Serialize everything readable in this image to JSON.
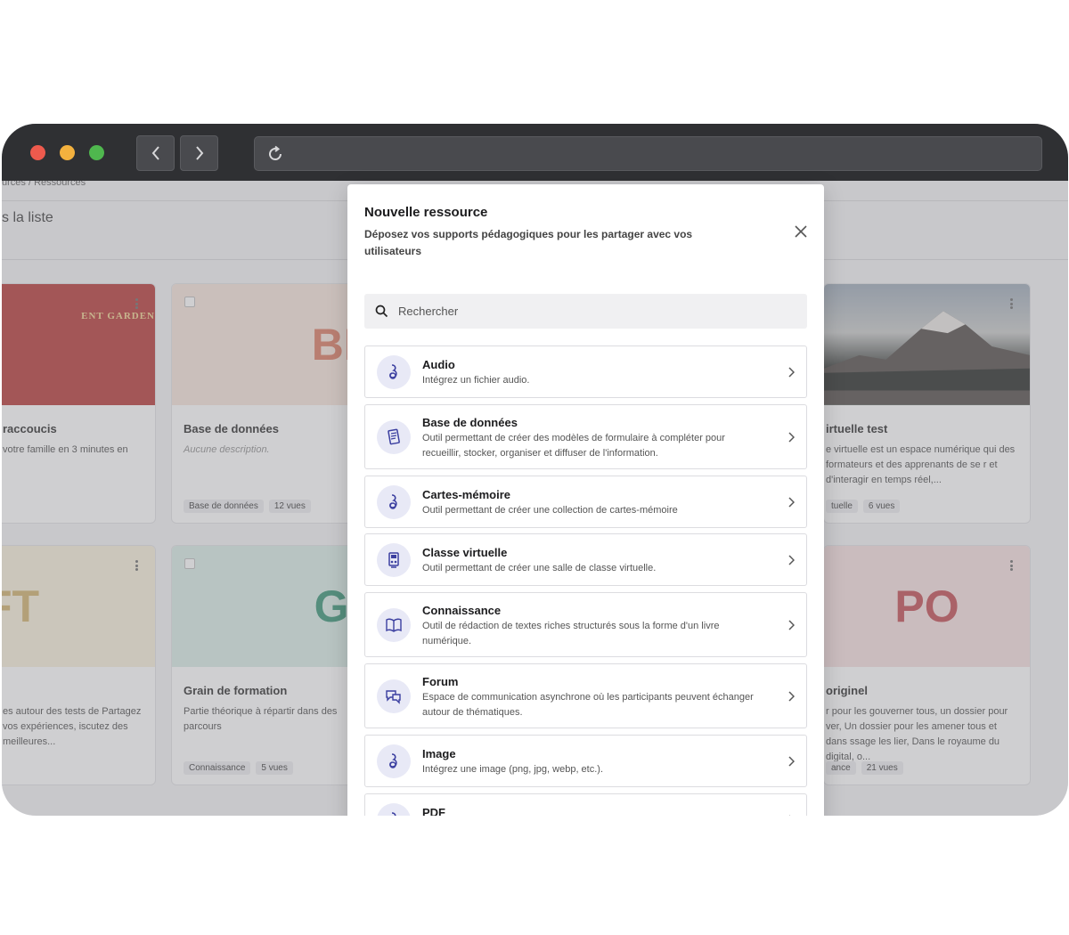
{
  "browser": {
    "traffic_lights": [
      "close",
      "minimize",
      "maximize"
    ],
    "icons": {
      "back": "chevron-left-icon",
      "forward": "chevron-right-icon",
      "reload": "reload-icon"
    },
    "url": ""
  },
  "background_page": {
    "breadcrumb": "urces  /  Ressources",
    "list_title": "s la liste",
    "cards": [
      {
        "cover_text": "ENT GARDEN",
        "title": "raccoucis",
        "desc": "votre famille en 3 minutes en",
        "tags": []
      },
      {
        "cover_text": "BD",
        "title": "Base de données",
        "desc": "Aucune description.",
        "tags": [
          "Base de données",
          "12 vues"
        ]
      },
      {
        "cover_text": "",
        "title": "irtuelle test",
        "desc": "e virtuelle est un espace numérique qui des formateurs et des apprenants de se r et d'interagir en temps réel,...",
        "tags": [
          "tuelle",
          "6 vues"
        ]
      },
      {
        "cover_text": "FT",
        "title": "",
        "desc": "es autour des tests de Partagez vos expériences, iscutez des meilleures...",
        "tags": []
      },
      {
        "cover_text": "GF",
        "title": "Grain de formation",
        "desc": "Partie théorique à répartir dans des parcours",
        "tags": [
          "Connaissance",
          "5 vues"
        ]
      },
      {
        "cover_text": "PO",
        "title": "originel",
        "desc": "r pour les gouverner tous, un dossier pour ver, Un dossier pour les amener tous et dans ssage les lier, Dans le royaume du digital, o...",
        "tags": [
          "ance",
          "21 vues"
        ]
      }
    ],
    "colors": {
      "bd": "#d9a08a",
      "gf": "#2e8f6e",
      "ft": "#cfae66",
      "po": "#c0444a"
    }
  },
  "modal": {
    "title": "Nouvelle ressource",
    "subtitle": "Déposez vos supports pédagogiques pour les partager avec vos utilisateurs",
    "close_icon": "close-icon",
    "search": {
      "placeholder": "Rechercher",
      "icon": "search-icon"
    },
    "items": [
      {
        "title": "Audio",
        "desc": "Intégrez un fichier audio.",
        "icon": "audio-icon"
      },
      {
        "title": "Base de données",
        "desc": "Outil permettant de créer des modèles de formulaire à compléter pour recueillir, stocker, organiser et diffuser de l'information.",
        "icon": "database-icon"
      },
      {
        "title": "Cartes-mémoire",
        "desc": "Outil permettant de créer une collection de cartes-mémoire",
        "icon": "flashcards-icon"
      },
      {
        "title": "Classe virtuelle",
        "desc": "Outil permettant de créer une salle de classe virtuelle.",
        "icon": "virtual-class-icon"
      },
      {
        "title": "Connaissance",
        "desc": "Outil de rédaction de textes riches structurés sous la forme d'un livre numérique.",
        "icon": "book-icon"
      },
      {
        "title": "Forum",
        "desc": "Espace de communication asynchrone où les participants peuvent échanger autour de thématiques.",
        "icon": "forum-icon"
      },
      {
        "title": "Image",
        "desc": "Intégrez une image (png, jpg, webp, etc.).",
        "icon": "image-icon"
      },
      {
        "title": "PDF",
        "desc": "",
        "icon": "pdf-icon"
      }
    ],
    "accent": "#3b3fa0"
  }
}
